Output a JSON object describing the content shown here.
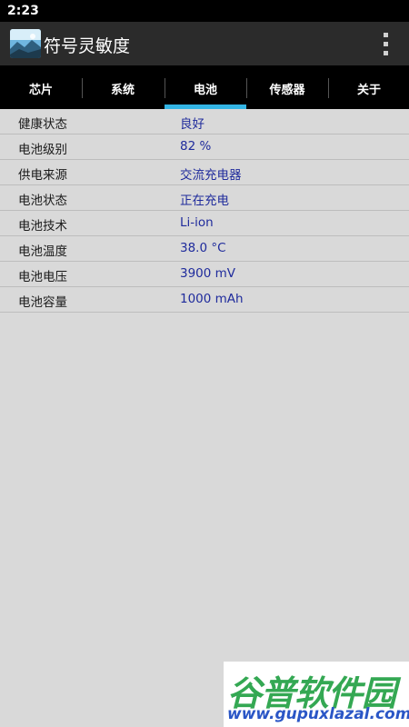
{
  "status_bar": {
    "time": "2:23"
  },
  "app_bar": {
    "title": "符号灵敏度"
  },
  "tabs": [
    {
      "label": "芯片",
      "selected": false
    },
    {
      "label": "系统",
      "selected": false
    },
    {
      "label": "电池",
      "selected": true
    },
    {
      "label": "传感器",
      "selected": false
    },
    {
      "label": "关于",
      "selected": false
    }
  ],
  "battery_info": [
    {
      "label": "健康状态",
      "value": "良好"
    },
    {
      "label": "电池级别",
      "value": "82 %"
    },
    {
      "label": "供电来源",
      "value": "交流充电器"
    },
    {
      "label": "电池状态",
      "value": "正在充电"
    },
    {
      "label": "电池技术",
      "value": "Li-ion"
    },
    {
      "label": "电池温度",
      "value": "38.0 °C"
    },
    {
      "label": "电池电压",
      "value": "3900 mV"
    },
    {
      "label": "电池容量",
      "value": "1000 mAh"
    }
  ],
  "watermark": {
    "text": "谷普软件园",
    "url": "www.gupuxlazal.com"
  },
  "colors": {
    "accent": "#33b5e5",
    "value_text": "#1f2b9c",
    "background": "#d9d9d9",
    "app_bar": "#2b2b2b",
    "tab_bar": "#000000"
  },
  "icons": {
    "app": "app-icon",
    "menu": "overflow-menu-icon"
  }
}
